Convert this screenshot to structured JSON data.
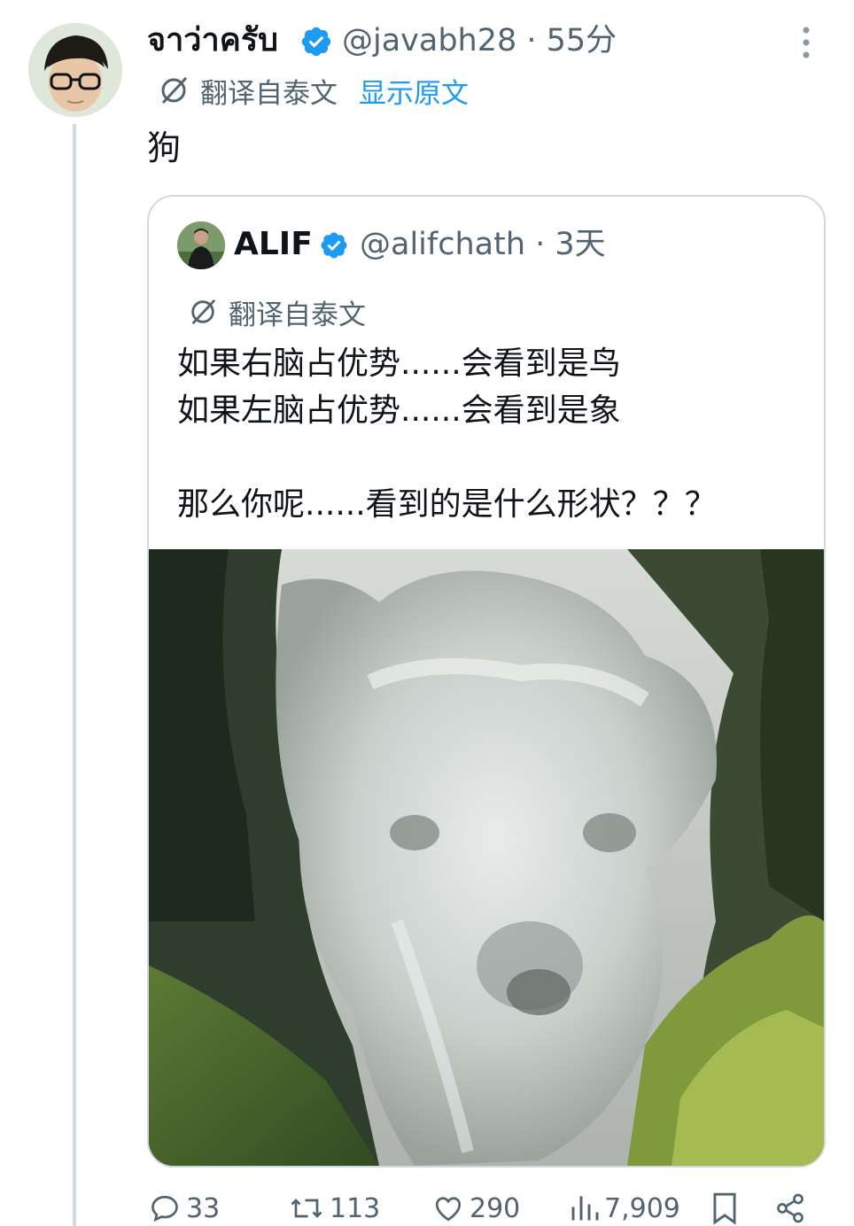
{
  "tweet": {
    "author_name": "จาว่าครับ",
    "handle_time": "@javabh28 · 55分",
    "translate_label": "翻译自泰文",
    "show_original": "显示原文",
    "text": "狗"
  },
  "quoted": {
    "author_name": "ALIF",
    "handle_time": "@alifchath · 3天",
    "translate_label": "翻译自泰文",
    "text": "如果右脑占优势......会看到是鸟\n如果左脑占优势......会看到是象\n\n那么你呢......看到的是什么形状？？？"
  },
  "actions": {
    "replies": "33",
    "retweets": "113",
    "likes": "290",
    "views": "7,909"
  },
  "icons": [
    "verified-badge-icon",
    "more-dots-icon",
    "translate-icon",
    "reply-icon",
    "retweet-icon",
    "like-icon",
    "views-icon",
    "bookmark-icon",
    "share-icon"
  ],
  "colors": {
    "accent": "#1d9bf0",
    "secondary_text": "#536471",
    "border": "#cfd9de"
  }
}
